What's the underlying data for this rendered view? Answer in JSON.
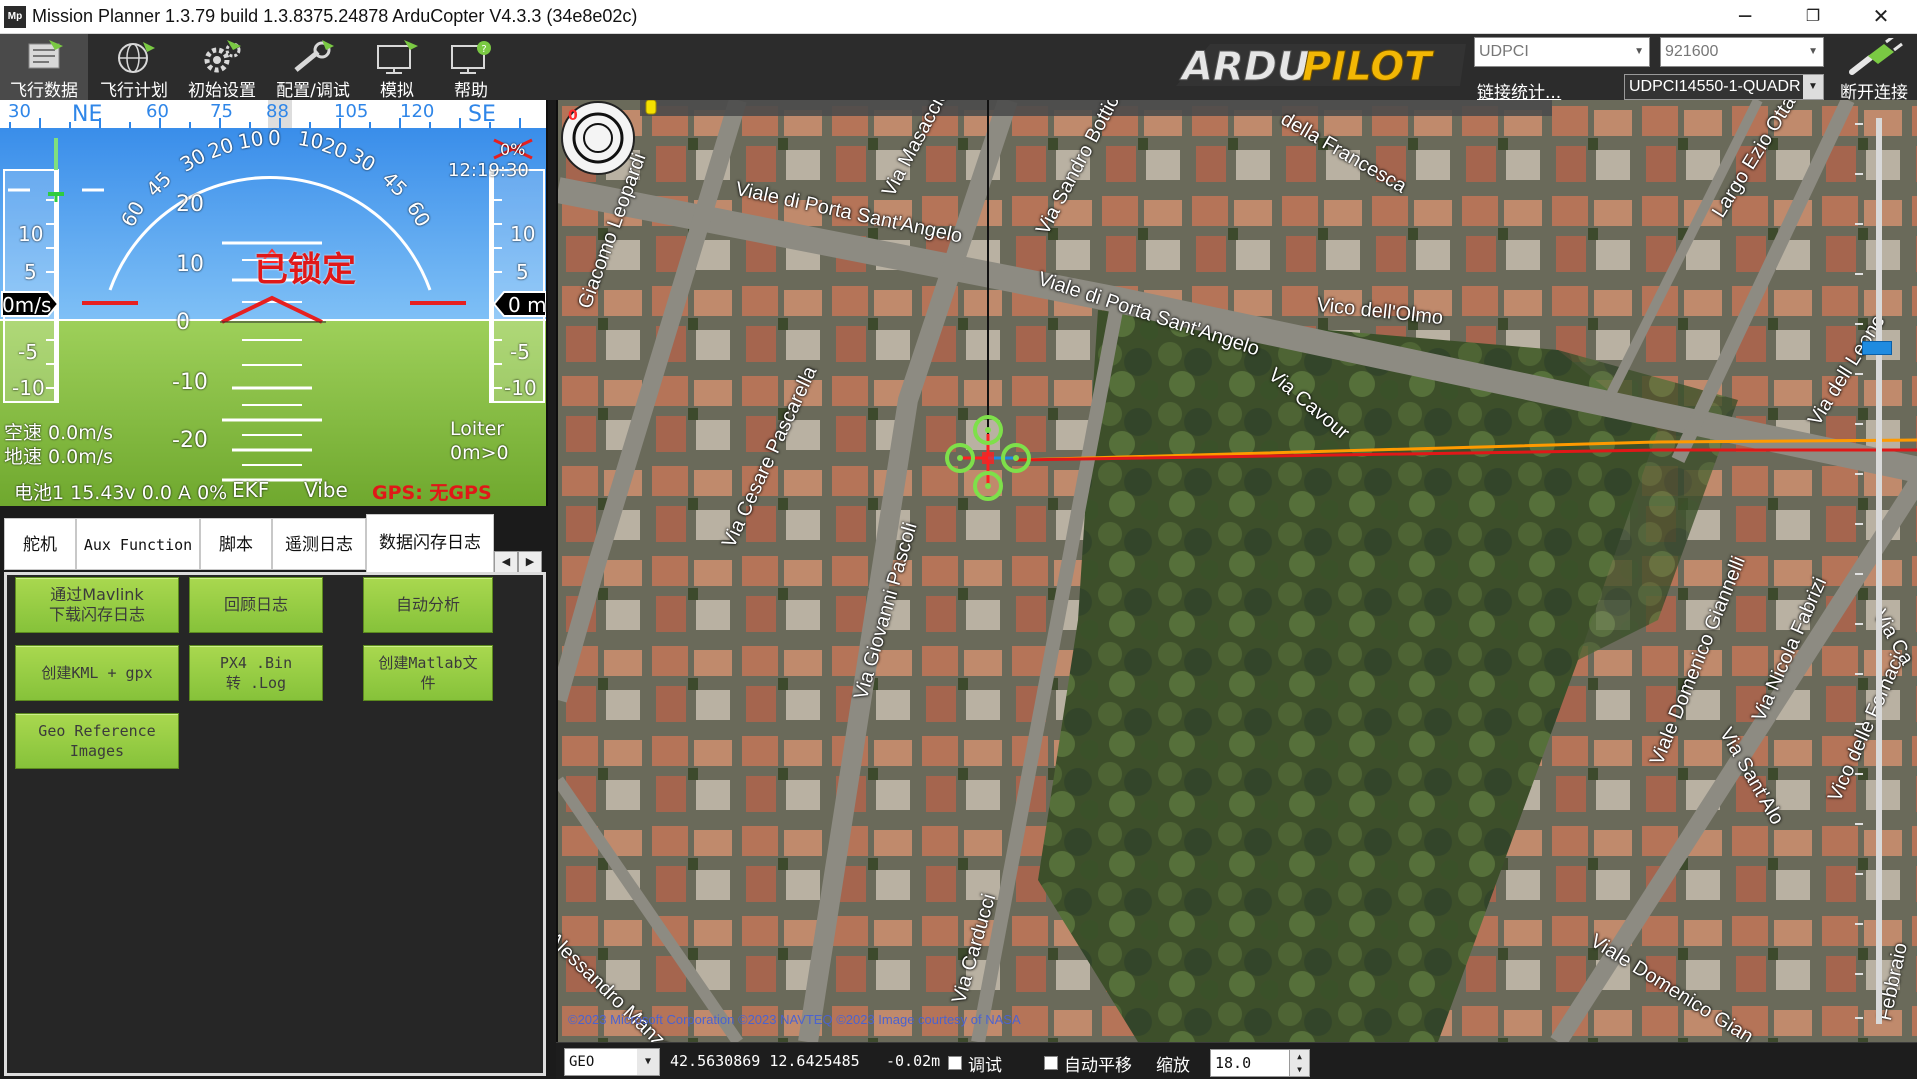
{
  "window": {
    "title": "Mission Planner 1.3.79 build 1.3.8375.24878 ArduCopter V4.3.3 (34e8e02c)",
    "icon": "mp-app-icon",
    "minimize": "─",
    "maximize": "❐",
    "close": "✕"
  },
  "toolbar": {
    "items": [
      {
        "label": "飞行数据",
        "icon": "flight-data-icon"
      },
      {
        "label": "飞行计划",
        "icon": "flight-plan-icon"
      },
      {
        "label": "初始设置",
        "icon": "initial-setup-icon"
      },
      {
        "label": "配置/调试",
        "icon": "config-tuning-icon"
      },
      {
        "label": "模拟",
        "icon": "simulation-icon"
      },
      {
        "label": "帮助",
        "icon": "help-icon"
      }
    ],
    "logo_text": "ARDUPILOT",
    "port": "UDPCI",
    "baud": "921600",
    "link_stats": "链接统计...",
    "vehicle": "UDPCI14550-1-QUADR",
    "disconnect": "断开连接"
  },
  "hud": {
    "heading_ticks": [
      "30",
      "NE",
      "60",
      "75",
      "88",
      "105",
      "120",
      "SE"
    ],
    "heading_value": 88,
    "time": "12:19:30",
    "battery_pct_label": "0%",
    "armed_status": "已锁定",
    "left_tape": [
      "10",
      "5",
      "-5",
      "-10"
    ],
    "right_tape": [
      "10",
      "5",
      "-5",
      "-10"
    ],
    "speed_readout": "0m/s",
    "alt_readout": "0 m",
    "pitch_labels": [
      "20",
      "10",
      "0",
      "-10",
      "-20"
    ],
    "roll_labels": [
      "60",
      "45",
      "30",
      "20",
      "10",
      "0",
      "10",
      "20",
      "30",
      "45",
      "60"
    ],
    "airspeed": "空速 0.0m/s",
    "groundspeed": "地速 0.0m/s",
    "mode": "Loiter",
    "wp_dist": "0m>0",
    "battery": "电池1 15.43v 0.0 A 0%",
    "ekf": "EKF",
    "vibe": "Vibe",
    "gps": "GPS: 无GPS",
    "colors": {
      "sky": "#4aa3f0",
      "ground": "#8cc63f",
      "gps_warn": "#e01818",
      "armed_text": "#e01818"
    }
  },
  "tabs": [
    {
      "label": "舵机"
    },
    {
      "label": "Aux Function"
    },
    {
      "label": "脚本"
    },
    {
      "label": "遥测日志"
    },
    {
      "label": "数据闪存日志"
    }
  ],
  "active_tab": "数据闪存日志",
  "logs_buttons": {
    "download": "通过Mavlink\n下载闪存日志",
    "review": "回顾日志",
    "auto": "自动分析",
    "kml": "创建KML + gpx",
    "px4": "PX4 .Bin\n转 .Log",
    "matlab": "创建Matlab文\n件",
    "geo": "Geo Reference\nImages"
  },
  "map": {
    "counter": "0",
    "streets": [
      "Viale di Porta Sant'Angelo",
      "Viale di Porta Sant'Angelo",
      "Via Masaccio",
      "Via Sandro Botticelli",
      "della Francesca",
      "Largo Ezio Ottaviani",
      "Giacomo Leopardi",
      "Vico dell'Olmo",
      "Via Cesare Pascarella",
      "Via Cavour",
      "Via dell Leone",
      "Via Giovanni Pascoli",
      "Viale Domenico Giannelli",
      "Via Nicola Fabrizi",
      "Via Sant'Alo",
      "Vico delle Fornaci",
      "Via Ca",
      "Viale Domenico Gian",
      "Via Carducci",
      "Alessandro Manzoni",
      "Febbraio"
    ],
    "copyright": "©2023 Microsoft Corporation ©2023 NAVTEQ ©2023 Image courtesy of NASA"
  },
  "statusbar": {
    "coord_type": "GEO",
    "coords": "42.5630869 12.6425485",
    "alt": "-0.02m",
    "debug_label": "调试",
    "autopan_label": "自动平移",
    "zoom_label": "缩放",
    "zoom_value": "18.0"
  }
}
